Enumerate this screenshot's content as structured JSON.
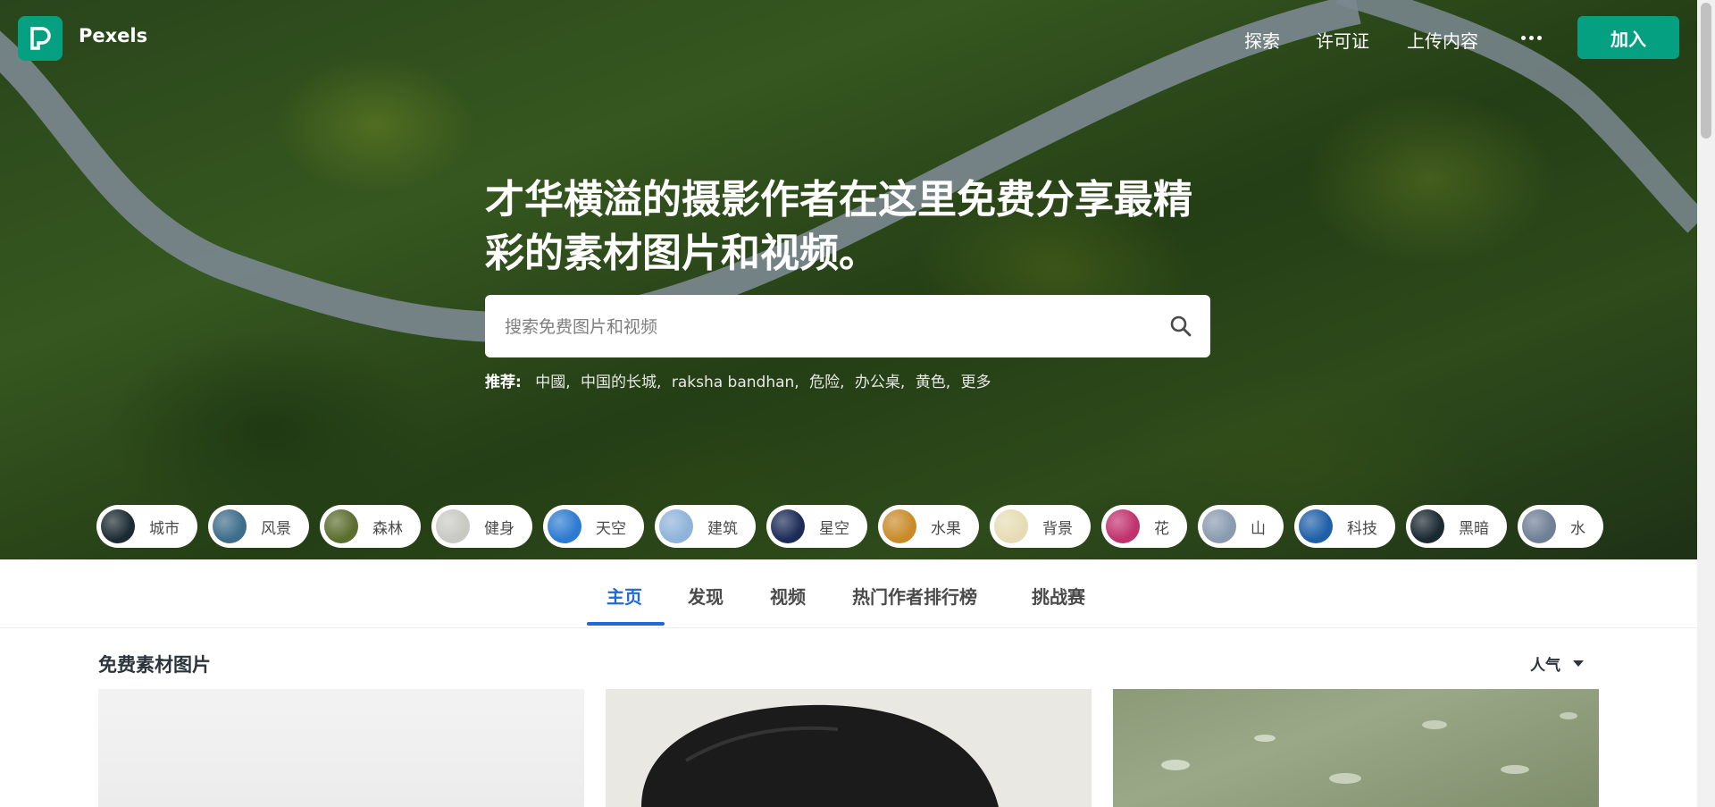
{
  "brand": {
    "name": "Pexels",
    "accent": "#05a081"
  },
  "nav": {
    "explore": "探索",
    "license": "许可证",
    "upload": "上传内容",
    "join": "加入"
  },
  "hero": {
    "headline": "才华横溢的摄影作者在这里免费分享最精彩的素材图片和视频。",
    "search_placeholder": "搜索免费图片和视频",
    "suggest_label": "推荐:",
    "suggestions": [
      "中國",
      "中国的长城",
      "raksha bandhan",
      "危险",
      "办公桌",
      "黄色",
      "更多"
    ]
  },
  "categories": [
    {
      "label": "城市",
      "color": "#1c2b33"
    },
    {
      "label": "风景",
      "color": "#3d6d8a"
    },
    {
      "label": "森林",
      "color": "#5b6e2e"
    },
    {
      "label": "健身",
      "color": "#c9c9c4"
    },
    {
      "label": "天空",
      "color": "#2d7ad1"
    },
    {
      "label": "建筑",
      "color": "#8fb3d9"
    },
    {
      "label": "星空",
      "color": "#1d2c57"
    },
    {
      "label": "水果",
      "color": "#c98b2a"
    },
    {
      "label": "背景",
      "color": "#e6dcb4"
    },
    {
      "label": "花",
      "color": "#c0326d"
    },
    {
      "label": "山",
      "color": "#8a9bb0"
    },
    {
      "label": "科技",
      "color": "#1f5fa8"
    },
    {
      "label": "黑暗",
      "color": "#1a2830"
    },
    {
      "label": "水",
      "color": "#6f7f95"
    }
  ],
  "tabs": [
    "主页",
    "发现",
    "视频",
    "热门作者排行榜",
    "挑战赛"
  ],
  "section": {
    "title": "免费素材图片",
    "sort_label": "人气"
  },
  "tab_active_color": "#1e6ad8"
}
